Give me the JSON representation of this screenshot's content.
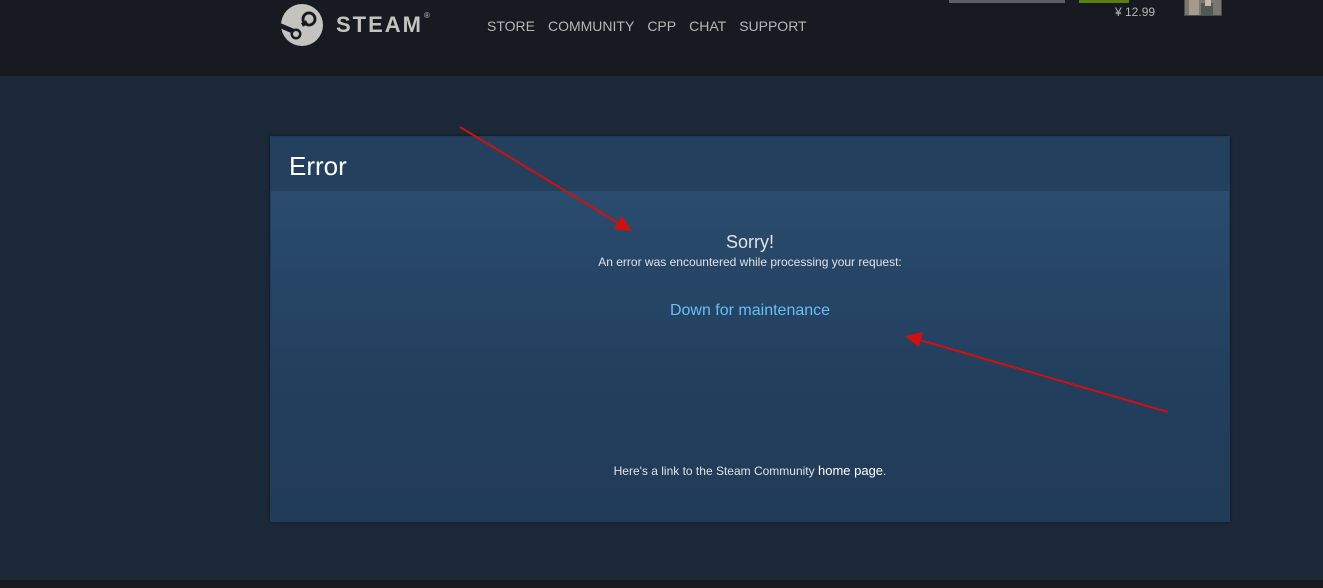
{
  "header": {
    "logo_text": "STEAM",
    "logo_trademark": "®",
    "nav": [
      "STORE",
      "COMMUNITY",
      "CPP",
      "CHAT",
      "SUPPORT"
    ],
    "wallet_balance": "¥ 12.99"
  },
  "error_panel": {
    "title": "Error",
    "sorry": "Sorry!",
    "subtitle": "An error was encountered while processing your request:",
    "message": "Down for maintenance",
    "footer_prefix": "Here's a link to the Steam Community ",
    "footer_link": "home page",
    "footer_suffix": "."
  },
  "colors": {
    "page_background": "#1b2838",
    "header_background": "#171a21",
    "link_blue": "#66c0f4",
    "annotation_red": "#d01010"
  },
  "icons": {
    "logo": "steam-logo-icon",
    "avatar": "user-avatar"
  }
}
